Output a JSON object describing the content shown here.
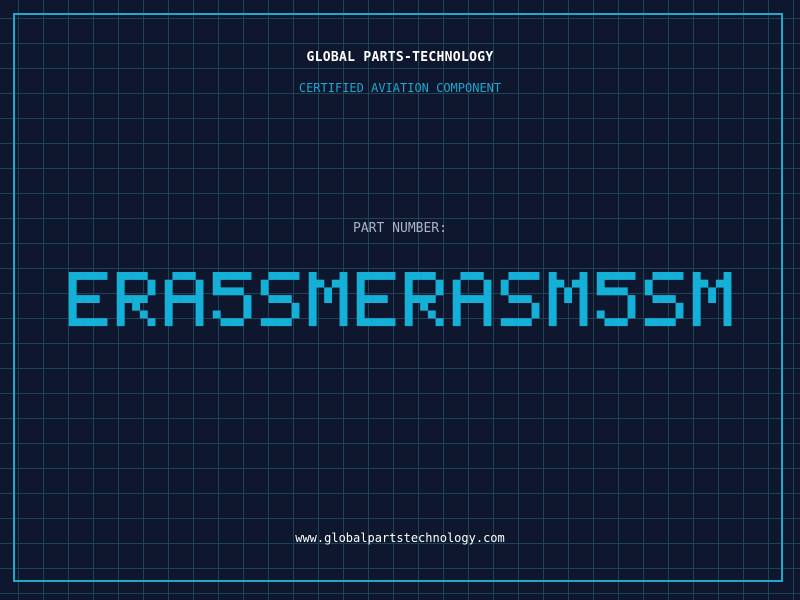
{
  "header": {
    "company": "GLOBAL PARTS-TECHNOLOGY",
    "tagline": "CERTIFIED AVIATION COMPONENT"
  },
  "part": {
    "label": "PART NUMBER:",
    "number": "ERA5SMERASM5SM"
  },
  "footer": {
    "website": "www.globalpartstechnology.com"
  },
  "colors": {
    "background": "#0f172e",
    "grid": "#1b4456",
    "frame": "#22a8cc",
    "part_number": "#15b0d8",
    "tagline": "#1ea5d0"
  }
}
